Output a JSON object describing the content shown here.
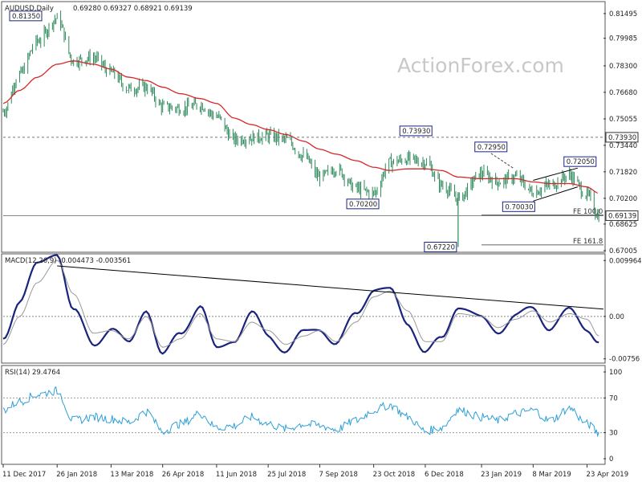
{
  "watermark": "ActionForex.com",
  "header": {
    "symbol": "AUDUSD,Daily",
    "ohlc": "0.69280 0.69327 0.68921 0.69139",
    "macd": "MACD(12,26,9) -0.004473 -0.003561",
    "rsi": "RSI(14) 29.4764"
  },
  "colors": {
    "candle": "#2d8a5b",
    "ema": "#d62828",
    "macd_line": "#1a237e",
    "macd_signal": "#999999",
    "rsi": "#2da0d8",
    "trendline": "#000000",
    "grid_dashed": "#777777"
  },
  "chart_data": [
    {
      "type": "candlestick",
      "title": "AUDUSD,Daily",
      "yticks": [
        "0.81495",
        "0.79985",
        "0.78300",
        "0.76680",
        "0.75055",
        "0.73440",
        "0.71820",
        "0.70200",
        "0.68625",
        "0.67005"
      ],
      "ylim": [
        0.67,
        0.82
      ],
      "xticks": [
        "11 Dec 2017",
        "26 Jan 2018",
        "13 Mar 2018",
        "26 Apr 2018",
        "11 Jun 2018",
        "25 Jul 2018",
        "7 Sep 2018",
        "23 Oct 2018",
        "6 Dec 2018",
        "23 Jan 2019",
        "8 Mar 2019",
        "23 Apr 2019"
      ],
      "x": [
        "2017-12-11",
        "2017-12-25",
        "2018-01-09",
        "2018-01-26",
        "2018-02-09",
        "2018-02-26",
        "2018-03-13",
        "2018-03-28",
        "2018-04-12",
        "2018-04-26",
        "2018-05-11",
        "2018-05-28",
        "2018-06-11",
        "2018-06-26",
        "2018-07-11",
        "2018-07-25",
        "2018-08-09",
        "2018-08-24",
        "2018-09-07",
        "2018-09-21",
        "2018-10-08",
        "2018-10-23",
        "2018-11-06",
        "2018-11-21",
        "2018-12-06",
        "2018-12-20",
        "2019-01-03",
        "2019-01-23",
        "2019-02-06",
        "2019-02-21",
        "2019-03-08",
        "2019-03-22",
        "2019-04-08",
        "2019-04-23",
        "2019-05-03"
      ],
      "close": [
        0.755,
        0.778,
        0.798,
        0.812,
        0.786,
        0.788,
        0.779,
        0.769,
        0.77,
        0.758,
        0.757,
        0.759,
        0.752,
        0.738,
        0.739,
        0.74,
        0.738,
        0.728,
        0.715,
        0.72,
        0.708,
        0.705,
        0.724,
        0.726,
        0.724,
        0.71,
        0.702,
        0.717,
        0.712,
        0.715,
        0.706,
        0.71,
        0.716,
        0.704,
        0.6914
      ],
      "ema": [
        0.76,
        0.768,
        0.776,
        0.784,
        0.786,
        0.784,
        0.781,
        0.776,
        0.774,
        0.77,
        0.766,
        0.763,
        0.76,
        0.751,
        0.747,
        0.744,
        0.741,
        0.737,
        0.732,
        0.729,
        0.725,
        0.721,
        0.719,
        0.72,
        0.72,
        0.719,
        0.715,
        0.714,
        0.714,
        0.714,
        0.712,
        0.711,
        0.711,
        0.709,
        0.705
      ],
      "annotations": [
        {
          "label": "0.81350",
          "date": "2018-01-26",
          "price": 0.8135
        },
        {
          "label": "0.73930",
          "date": "2018-11-28",
          "price": 0.7393
        },
        {
          "label": "0.72950",
          "date": "2019-01-31",
          "price": 0.7295
        },
        {
          "label": "0.72050",
          "date": "2019-04-17",
          "price": 0.7205
        },
        {
          "label": "0.70200",
          "date": "2018-10-26",
          "price": 0.702
        },
        {
          "label": "0.70030",
          "date": "2019-03-08",
          "price": 0.7003
        },
        {
          "label": "0.67220",
          "date": "2019-01-03",
          "price": 0.6722
        }
      ],
      "levels": [
        {
          "label": "0.73930",
          "price": 0.7393,
          "style": "dashed"
        },
        {
          "label": "0.69139",
          "price": 0.69139,
          "style": "current"
        }
      ],
      "fe_lines": [
        {
          "label": "FE 100.0",
          "price": 0.6917
        },
        {
          "label": "FE 161.8",
          "price": 0.6735
        }
      ]
    },
    {
      "type": "line",
      "title": "MACD(12,26,9) -0.004473 -0.003561",
      "yticks": [
        "0.009964",
        "0.00",
        "-0.00756"
      ],
      "ylim": [
        -0.0095,
        0.012
      ],
      "series": [
        {
          "name": "MACD",
          "values": [
            -0.004,
            0.003,
            0.009,
            0.0115,
            0.001,
            -0.005,
            -0.002,
            -0.005,
            0.0015,
            -0.007,
            -0.003,
            0.002,
            -0.006,
            -0.004,
            0.0005,
            -0.0035,
            -0.006,
            -0.003,
            -0.002,
            -0.005,
            0.0005,
            0.005,
            0.0045,
            -0.001,
            -0.0065,
            -0.004,
            0.002,
            -0.0005,
            -0.0025,
            0.0,
            0.0015,
            -0.002,
            0.001,
            -0.002,
            -0.0045
          ]
        },
        {
          "name": "Signal",
          "values": [
            -0.005,
            0.0,
            0.006,
            0.01,
            0.004,
            -0.003,
            -0.0025,
            -0.004,
            0.0,
            -0.0055,
            -0.004,
            0.0005,
            -0.004,
            -0.0045,
            -0.001,
            -0.0025,
            -0.005,
            -0.0035,
            -0.0025,
            -0.0045,
            -0.001,
            0.0035,
            0.0045,
            0.001,
            -0.0045,
            -0.0045,
            0.0005,
            0.0,
            -0.002,
            -0.0005,
            0.001,
            -0.001,
            0.0005,
            -0.0005,
            -0.0035
          ]
        }
      ]
    },
    {
      "type": "line",
      "title": "RSI(14) 29.4764",
      "yticks": [
        "100",
        "70",
        "30",
        "0"
      ],
      "ylim": [
        0,
        100
      ],
      "series": [
        {
          "name": "RSI(14)",
          "values": [
            56,
            66,
            74,
            78,
            44,
            48,
            46,
            42,
            54,
            32,
            40,
            52,
            36,
            38,
            48,
            40,
            34,
            40,
            38,
            34,
            44,
            56,
            62,
            48,
            32,
            36,
            56,
            48,
            44,
            52,
            56,
            44,
            58,
            40,
            29.5
          ]
        }
      ]
    }
  ]
}
